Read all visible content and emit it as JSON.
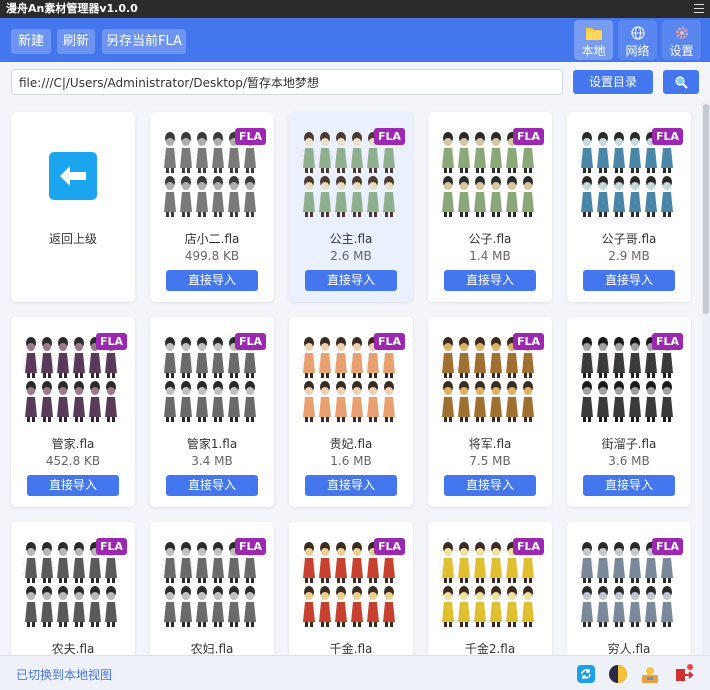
{
  "window": {
    "title": "漫舟An素材管理器v1.0.0"
  },
  "toolbar": {
    "new_label": "新建",
    "refresh_label": "刷新",
    "save_as_label": "另存当前FLA",
    "tabs": [
      {
        "label": "本地",
        "icon": "folder-icon",
        "active": true
      },
      {
        "label": "网络",
        "icon": "globe-icon",
        "active": false
      },
      {
        "label": "设置",
        "icon": "gear-icon",
        "active": false
      }
    ]
  },
  "pathbar": {
    "path": "file:///C|/Users/Administrator/Desktop/暂存本地梦想",
    "set_dir_label": "设置目录",
    "search_icon": "search-icon"
  },
  "grid": {
    "back_label": "返回上级",
    "badge": "FLA",
    "import_label": "直接导入",
    "items": [
      {
        "name": "店小二.fla",
        "size": "499.8 KB",
        "palette": [
          "#7a7a7a",
          "#b0b0b0",
          "#3a3a3a"
        ]
      },
      {
        "name": "公主.fla",
        "size": "2.6 MB",
        "palette": [
          "#8fb08f",
          "#e8e0c8",
          "#4a3a30"
        ]
      },
      {
        "name": "公子.fla",
        "size": "1.4 MB",
        "palette": [
          "#8aa878",
          "#d8c8a0",
          "#2a2a2a"
        ]
      },
      {
        "name": "公子哥.fla",
        "size": "2.9 MB",
        "palette": [
          "#4a86a8",
          "#c8d8e0",
          "#2a2a2a"
        ]
      },
      {
        "name": "管家.fla",
        "size": "452.8 KB",
        "palette": [
          "#5a3a5a",
          "#9a7a8a",
          "#2a2a2a"
        ]
      },
      {
        "name": "管家1.fla",
        "size": "3.4 MB",
        "palette": [
          "#6a6a6a",
          "#c0c0c0",
          "#2a2a2a"
        ]
      },
      {
        "name": "贵妃.fla",
        "size": "1.6 MB",
        "palette": [
          "#e8a070",
          "#f0d0b0",
          "#3a2a20"
        ]
      },
      {
        "name": "将军.fla",
        "size": "7.5 MB",
        "palette": [
          "#a07030",
          "#e0b060",
          "#3a2a20"
        ]
      },
      {
        "name": "街溜子.fla",
        "size": "3.6 MB",
        "palette": [
          "#3a3a3a",
          "#a0a0a0",
          "#1a1a1a"
        ]
      },
      {
        "name": "农夫.fla",
        "size": "",
        "palette": [
          "#5a5a5a",
          "#b8b8b8",
          "#2a2a2a"
        ]
      },
      {
        "name": "农妇.fla",
        "size": "",
        "palette": [
          "#6a6a6a",
          "#c0c0c0",
          "#2a2a2a"
        ]
      },
      {
        "name": "千金.fla",
        "size": "",
        "palette": [
          "#c84030",
          "#e8d090",
          "#3a2a20"
        ]
      },
      {
        "name": "千金2.fla",
        "size": "",
        "palette": [
          "#e0c030",
          "#f0e0a0",
          "#3a2a20"
        ]
      },
      {
        "name": "穷人.fla",
        "size": "",
        "palette": [
          "#7a8a9a",
          "#c0c8d0",
          "#2a2a2a"
        ]
      }
    ]
  },
  "status": {
    "text": "已切换到本地视图",
    "icons": [
      "refresh-icon",
      "theme-toggle-icon",
      "user-icon",
      "logout-icon"
    ]
  }
}
